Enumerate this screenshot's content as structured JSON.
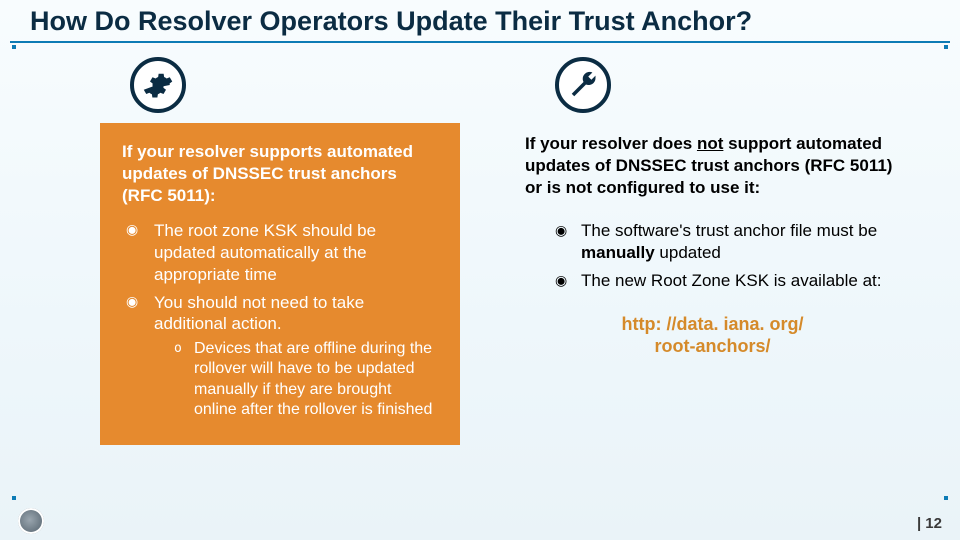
{
  "title": "How Do Resolver Operators Update Their Trust Anchor?",
  "left": {
    "icon": "gear-icon",
    "intro": "If your resolver supports automated updates of DNSSEC trust anchors (RFC 5011):",
    "bullets": [
      "The root zone KSK should be updated automatically at the appropriate time",
      "You should not need to take additional action."
    ],
    "sub": "Devices that are offline during the rollover will have to be updated manually if they are brought online after the rollover is finished"
  },
  "right": {
    "icon": "wrench-icon",
    "intro_pre": "If your resolver does ",
    "intro_not": "not",
    "intro_post": " support automated updates of DNSSEC trust anchors (RFC 5011) or is not configured to use it:",
    "bullets": [
      "The software's trust anchor file must be manually updated",
      "The new Root Zone KSK is available at:"
    ],
    "link_line1": "http: //data. iana. org/",
    "link_line2": "root-anchors/"
  },
  "page": "| 12"
}
